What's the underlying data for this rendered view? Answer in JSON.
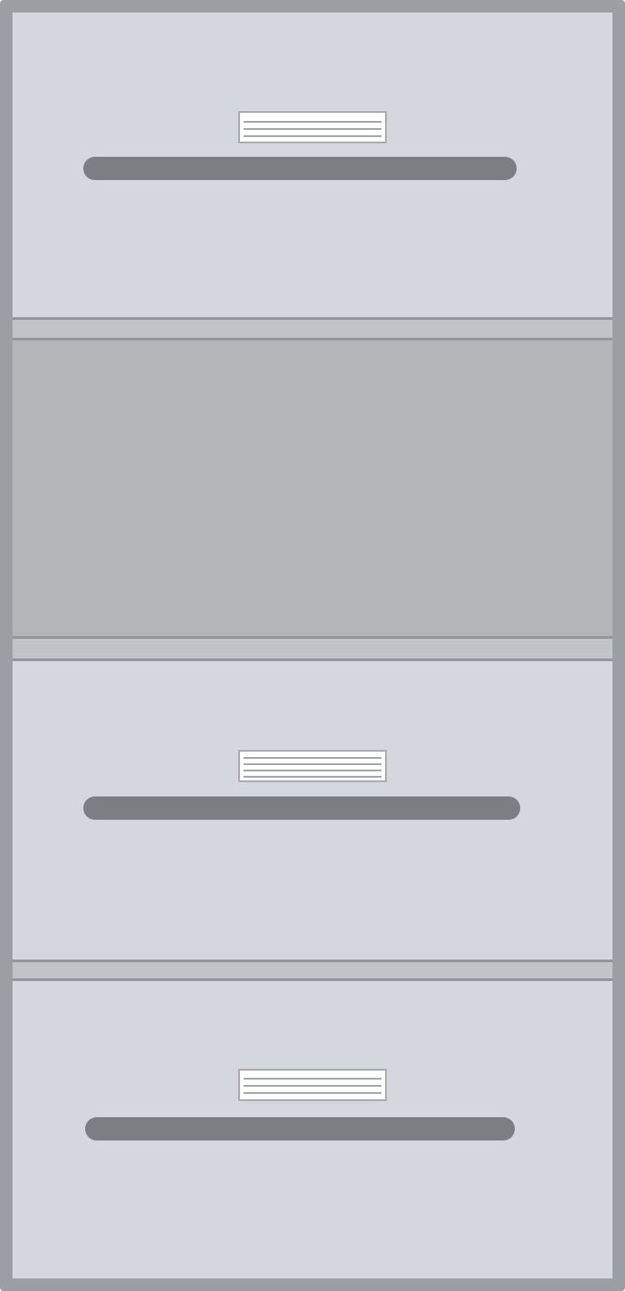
{
  "cabinet": {
    "drawers": [
      {
        "state": "closed",
        "label_lines": 3
      },
      {
        "state": "open",
        "label_lines": 0
      },
      {
        "state": "closed",
        "label_lines": 4
      },
      {
        "state": "closed",
        "label_lines": 3
      }
    ],
    "colors": {
      "frame": "#9b9ea3",
      "drawer_face": "#d4d7de",
      "open_drawer": "#b3b5b9",
      "handle": "#7b7e83",
      "label": "#ffffff",
      "label_lines": "#a3a6ab",
      "seam": "#c0c3c8"
    }
  }
}
